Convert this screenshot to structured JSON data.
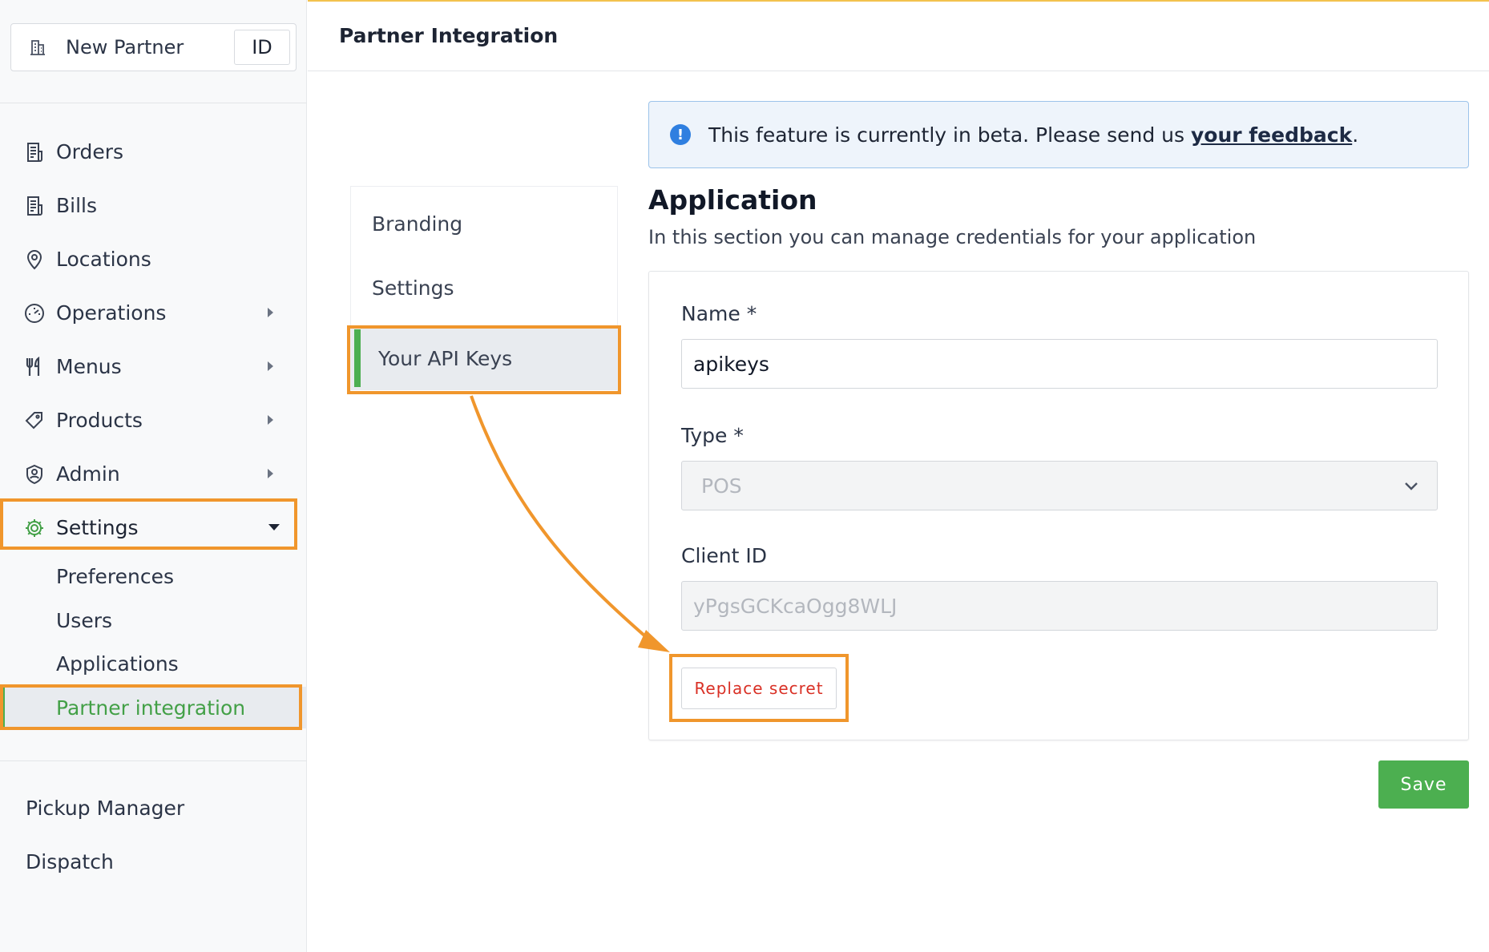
{
  "store": {
    "name": "New Partner",
    "code": "ID"
  },
  "sidebar": {
    "items": [
      {
        "label": "Orders",
        "icon": "receipt-icon"
      },
      {
        "label": "Bills",
        "icon": "receipt-icon"
      },
      {
        "label": "Locations",
        "icon": "location-pin-icon"
      },
      {
        "label": "Operations",
        "icon": "gauge-icon"
      },
      {
        "label": "Menus",
        "icon": "fork-knife-icon"
      },
      {
        "label": "Products",
        "icon": "tag-icon"
      },
      {
        "label": "Admin",
        "icon": "shield-user-icon"
      },
      {
        "label": "Settings",
        "icon": "gear-icon"
      }
    ],
    "settings_sub": [
      {
        "label": "Preferences"
      },
      {
        "label": "Users"
      },
      {
        "label": "Applications"
      },
      {
        "label": "Partner integration"
      }
    ],
    "bottom": [
      {
        "label": "Pickup Manager"
      },
      {
        "label": "Dispatch"
      }
    ]
  },
  "header": {
    "title": "Partner Integration"
  },
  "tabs": [
    {
      "label": "Branding"
    },
    {
      "label": "Settings"
    },
    {
      "label": "Your API Keys"
    }
  ],
  "beta_notice": {
    "text": "This feature is currently in beta. Please send us ",
    "link": "your feedback",
    "suffix": "."
  },
  "section": {
    "title": "Application",
    "description": "In this section you can manage credentials for your application"
  },
  "form": {
    "name_label": "Name *",
    "name_value": "apikeys",
    "type_label": "Type *",
    "type_value": "POS",
    "client_id_label": "Client ID",
    "client_id_value": "yPgsGCKcaOgg8WLJ",
    "replace_secret_label": "Replace secret",
    "save_label": "Save"
  },
  "colors": {
    "accent_green": "#4caf50",
    "highlight_orange": "#f0962c",
    "danger_red": "#d93025",
    "info_blue": "#2f7fe0"
  }
}
